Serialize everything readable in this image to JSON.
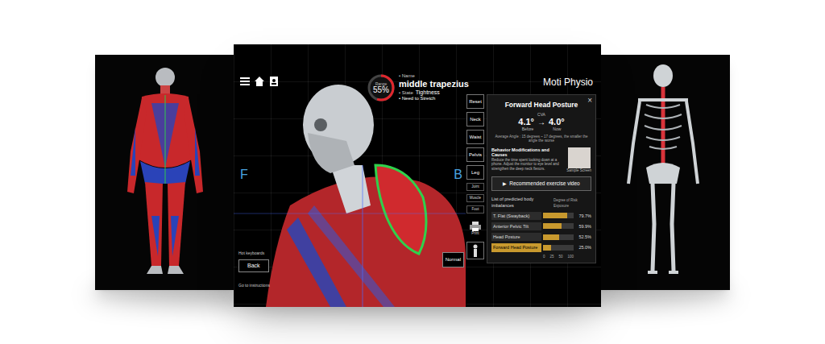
{
  "app": {
    "title": "Moti Physio",
    "front_label": "F",
    "back_label": "B"
  },
  "muscle": {
    "gauge_label": "Range",
    "gauge_value": "55%",
    "level": 0.55,
    "name_label": "• Name",
    "name": "middle trapezius",
    "state_label": "• State",
    "state": "Tightness",
    "advice": "• Need to Stretch"
  },
  "side_buttons": [
    {
      "label": "Reset",
      "kind": "main"
    },
    {
      "label": "Neck",
      "kind": "main"
    },
    {
      "label": "Waist",
      "kind": "main"
    },
    {
      "label": "Pelvis",
      "kind": "main"
    },
    {
      "label": "Leg",
      "kind": "main"
    },
    {
      "label": "Joint",
      "kind": "small"
    },
    {
      "label": "Muscle",
      "kind": "small"
    },
    {
      "label": "Foot",
      "kind": "small"
    }
  ],
  "print_label": "Print",
  "view_button": {
    "label": "Normal"
  },
  "footer": {
    "hint": "Hot keyboards",
    "back": "Back",
    "note": "Go to instructions"
  },
  "popup": {
    "title": "Forward Head Posture",
    "close": "×",
    "metric": "CVA",
    "before_value": "4.1°",
    "arrow": "→",
    "now_value": "4.0°",
    "before_label": "Before",
    "now_label": "Now",
    "caption": "Average Angle : 15 degrees ~ 17 degrees, the smaller the angle the worse",
    "behavior_title": "Behavior Modifications and Causes",
    "behavior_text": "Reduce the time spent looking down at a phone. Adjust the monitor to eye level and strengthen the deep neck flexors.",
    "sample_label": "Sample Screen",
    "video_icon": "▶",
    "video_button": "Recommended exercise video"
  },
  "imbalances": {
    "title": "List of predicted body imbalances",
    "value_title": "Degree of Risk Exposure",
    "ticks": [
      "0",
      "25",
      "50",
      "100"
    ],
    "values": [
      79.7,
      59.9,
      52.5,
      25.0
    ],
    "rows": [
      {
        "label": "T. Flat (Swayback)",
        "reading": "79.7%",
        "selected": false
      },
      {
        "label": "Anterior Pelvic Tilt",
        "reading": "59.9%",
        "selected": false
      },
      {
        "label": "Head Posture",
        "reading": "52.5%",
        "selected": false
      },
      {
        "label": "Forward Head Posture",
        "reading": "25.0%",
        "selected": true
      }
    ]
  }
}
